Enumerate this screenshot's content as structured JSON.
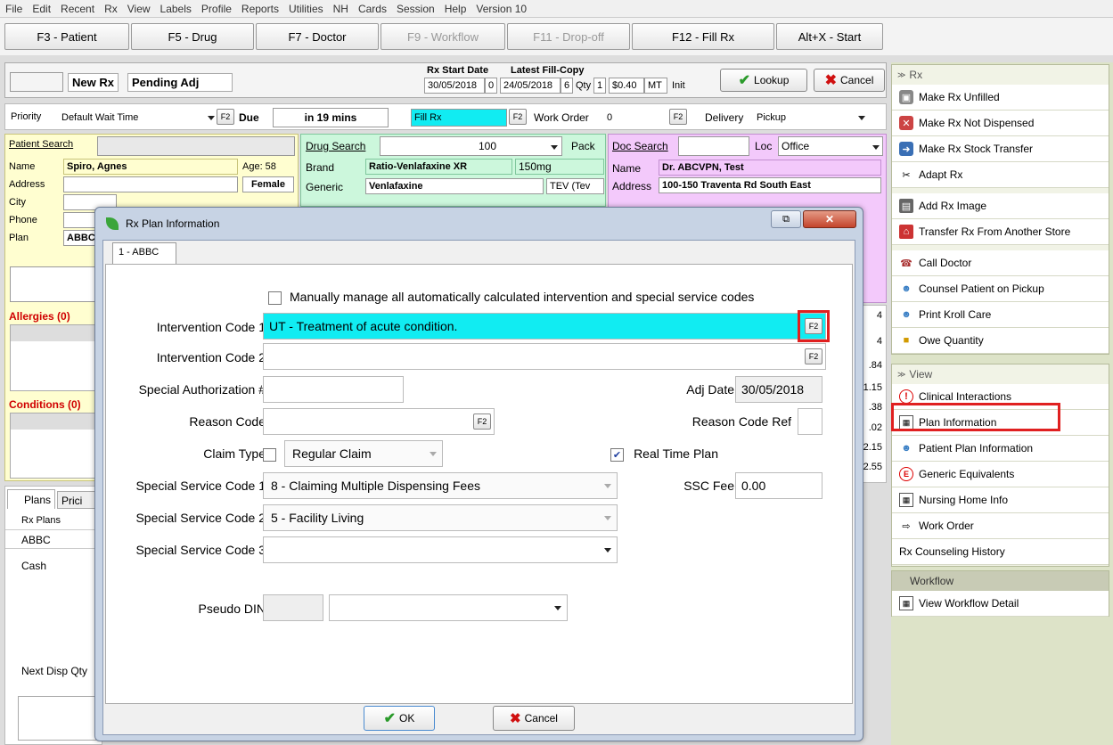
{
  "menu": [
    "File",
    "Edit",
    "Recent",
    "Rx",
    "View",
    "Labels",
    "Profile",
    "Reports",
    "Utilities",
    "NH",
    "Cards",
    "Session",
    "Help",
    "Version 10"
  ],
  "fkeys": [
    {
      "label": "F3 - Patient",
      "enabled": true
    },
    {
      "label": "F5 - Drug",
      "enabled": true
    },
    {
      "label": "F7 - Doctor",
      "enabled": true
    },
    {
      "label": "F9 - Workflow",
      "enabled": false
    },
    {
      "label": "F11 - Drop-off",
      "enabled": false
    },
    {
      "label": "F12 - Fill Rx",
      "enabled": true
    },
    {
      "label": "Alt+X - Start",
      "enabled": true
    }
  ],
  "rx": {
    "new_rx": "New Rx",
    "pending": "Pending Adj",
    "start_date_label": "Rx Start Date",
    "start_date": "30/05/2018",
    "start_n": "0",
    "latest_fill_label": "Latest Fill-Copy",
    "latest_fill": "24/05/2018",
    "latest_n": "6",
    "qty_label": "Qty",
    "qty": "1",
    "price": "$0.40",
    "mt": "MT",
    "init": "Init",
    "lookup": "Lookup",
    "cancel": "Cancel"
  },
  "row2": {
    "priority_label": "Priority",
    "priority": "Default Wait Time",
    "due_label": "Due",
    "due": "in 19 mins",
    "fill": "Fill Rx",
    "work_order_label": "Work Order",
    "work_order": "0",
    "delivery_label": "Delivery",
    "delivery": "Pickup",
    "f2": "F2"
  },
  "patient": {
    "search_label": "Patient Search",
    "name_label": "Name",
    "name": "Spiro, Agnes",
    "age": "Age: 58",
    "address_label": "Address",
    "gender": "Female",
    "city_label": "City",
    "phone_label": "Phone",
    "plan_label": "Plan",
    "plan": "ABBC",
    "allergies": "Allergies (0)",
    "conditions": "Conditions (0)"
  },
  "drug": {
    "search_label": "Drug Search",
    "search_val": "100",
    "pack": "Pack",
    "brand_label": "Brand",
    "brand": "Ratio-Venlafaxine XR",
    "strength": "150mg",
    "generic_label": "Generic",
    "generic": "Venlafaxine",
    "mfr": "TEV (Tev"
  },
  "doctor": {
    "search_label": "Doc Search",
    "loc_label": "Loc",
    "loc": "Office",
    "name_label": "Name",
    "name": "Dr. ABCVPN, Test",
    "address_label": "Address",
    "address": "100-150 Traventa Rd South East"
  },
  "pricing_vals": [
    "4",
    "4",
    ".84",
    "1.15",
    ".38",
    ".02",
    "2.15",
    "2.55"
  ],
  "bottom_tabs": {
    "plans": "Plans",
    "pricing": "Prici"
  },
  "plans_list": {
    "header": "Rx Plans",
    "items": [
      "ABBC",
      "Cash"
    ]
  },
  "next_disp": "Next Disp Qty",
  "dialog": {
    "title": "Rx Plan Information",
    "tab": "1 - ABBC",
    "manual_label": "Manually manage all automatically calculated intervention and special service codes",
    "ic1_label": "Intervention Code 1",
    "ic1": "UT - Treatment of acute condition.",
    "ic2_label": "Intervention Code 2",
    "ic2": "",
    "sa_label": "Special Authorization #",
    "sa": "",
    "adj_label": "Adj Date",
    "adj": "30/05/2018",
    "rc_label": "Reason Code",
    "rc": "",
    "rcref_label": "Reason Code Ref",
    "rcref": "",
    "claim_label": "Claim Type",
    "claim": "Regular Claim",
    "rtp_label": "Real Time Plan",
    "ssc1_label": "Special Service Code 1",
    "ssc1": "8 - Claiming Multiple Dispensing Fees",
    "ssc2_label": "Special Service Code 2",
    "ssc2": "5 - Facility Living",
    "ssc3_label": "Special Service Code 3",
    "ssc3": "",
    "sscfee_label": "SSC Fee",
    "sscfee": "0.00",
    "pdin_label": "Pseudo DIN",
    "ok": "OK",
    "cancel": "Cancel",
    "f2": "F2"
  },
  "sidebar": {
    "rx_header": "Rx",
    "rx_items": [
      "Make Rx Unfilled",
      "Make Rx Not Dispensed",
      "Make Rx Stock Transfer",
      "Adapt Rx",
      "Add Rx Image",
      "Transfer Rx From Another Store",
      "Call Doctor",
      "Counsel Patient on Pickup",
      "Print Kroll Care",
      "Owe Quantity"
    ],
    "view_header": "View",
    "view_items": [
      "Clinical Interactions",
      "Plan Information",
      "Patient Plan Information",
      "Generic Equivalents",
      "Nursing Home Info",
      "Work Order",
      "Rx Counseling History"
    ],
    "workflow_header": "Workflow",
    "workflow_items": [
      "View Workflow Detail"
    ]
  }
}
